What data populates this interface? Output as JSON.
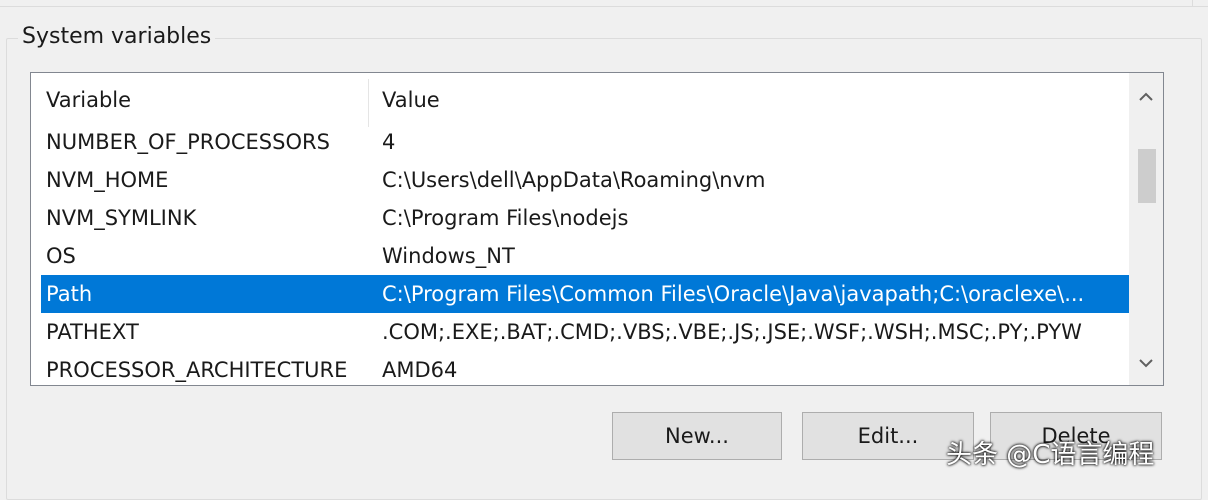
{
  "group": {
    "title": "System variables"
  },
  "columns": {
    "variable": "Variable",
    "value": "Value"
  },
  "rows": [
    {
      "variable": "NUMBER_OF_PROCESSORS",
      "value": "4"
    },
    {
      "variable": "NVM_HOME",
      "value": "C:\\Users\\dell\\AppData\\Roaming\\nvm"
    },
    {
      "variable": "NVM_SYMLINK",
      "value": "C:\\Program Files\\nodejs"
    },
    {
      "variable": "OS",
      "value": "Windows_NT"
    },
    {
      "variable": "Path",
      "value": "C:\\Program Files\\Common Files\\Oracle\\Java\\javapath;C:\\oraclexe\\..."
    },
    {
      "variable": "PATHEXT",
      "value": ".COM;.EXE;.BAT;.CMD;.VBS;.VBE;.JS;.JSE;.WSF;.WSH;.MSC;.PY;.PYW"
    },
    {
      "variable": "PROCESSOR_ARCHITECTURE",
      "value": "AMD64"
    }
  ],
  "selected_variable": "Path",
  "buttons": {
    "new": "New...",
    "edit": "Edit...",
    "delete": "Delete"
  },
  "scrollbar": {
    "up_icon": "chevron-up-icon",
    "down_icon": "chevron-down-icon"
  },
  "colors": {
    "selection": "#0078d7",
    "button_bg": "#e1e1e1"
  },
  "watermark": "头条 @C语言编程"
}
